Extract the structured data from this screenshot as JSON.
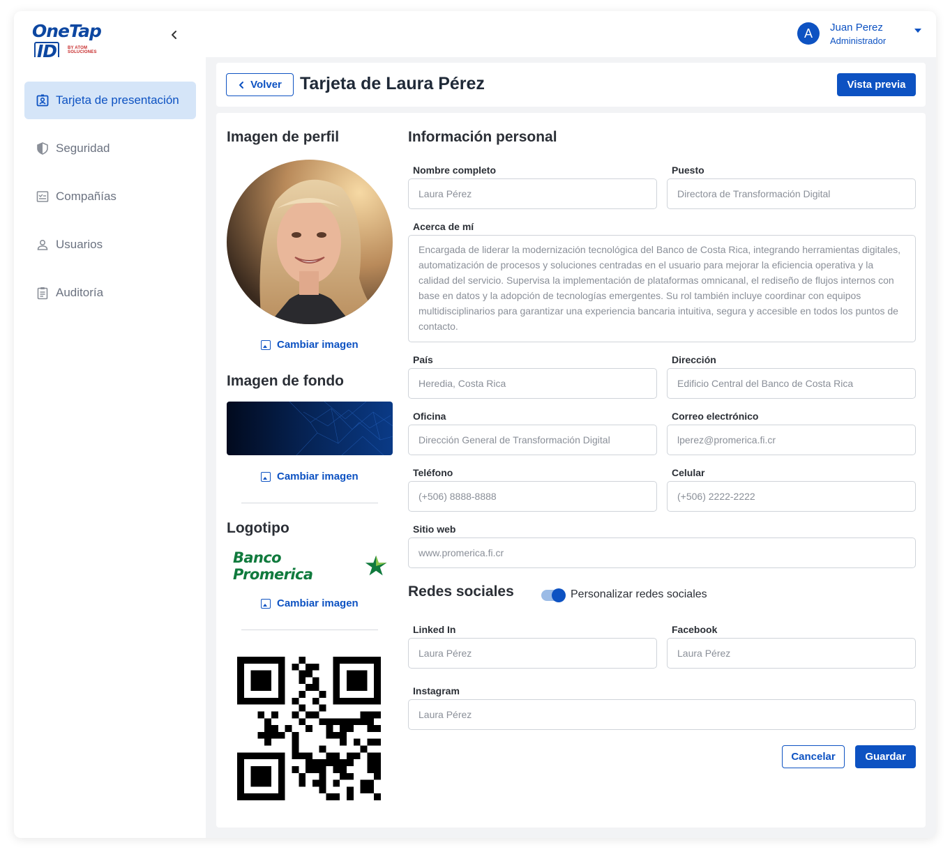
{
  "brand": {
    "logo_text": "OneTap",
    "logo_id": "ID",
    "logo_sub": "BY ATOM SOLUCIONES"
  },
  "user": {
    "initial": "A",
    "name": "Juan Perez",
    "role": "Administrador"
  },
  "sidebar": {
    "items": [
      {
        "label": "Tarjeta de presentación",
        "icon": "id-card-icon",
        "active": true
      },
      {
        "label": "Seguridad",
        "icon": "shield-icon",
        "active": false
      },
      {
        "label": "Compañías",
        "icon": "checklist-icon",
        "active": false
      },
      {
        "label": "Usuarios",
        "icon": "user-icon",
        "active": false
      },
      {
        "label": "Auditoría",
        "icon": "clipboard-icon",
        "active": false
      }
    ]
  },
  "header": {
    "back_label": "Volver",
    "title": "Tarjeta de Laura Pérez",
    "preview_label": "Vista previa"
  },
  "left_panel": {
    "profile_title": "Imagen de perfil",
    "change_image_label": "Cambiar imagen",
    "background_title": "Imagen de fondo",
    "logo_title": "Logotipo",
    "logo_brand_text": "Banco Promerica"
  },
  "personal": {
    "title": "Información personal",
    "fields": {
      "full_name": {
        "label": "Nombre completo",
        "value": "Laura Pérez"
      },
      "position": {
        "label": "Puesto",
        "value": "Directora de Transformación Digital"
      },
      "about": {
        "label": "Acerca de mí",
        "value": "Encargada de liderar la modernización tecnológica del Banco de Costa Rica, integrando herramientas digitales, automatización de procesos y soluciones centradas en el usuario para mejorar la eficiencia operativa y la calidad del servicio. Supervisa la implementación de plataformas omnicanal, el rediseño de flujos internos con base en datos y la adopción de tecnologías emergentes. Su rol también incluye coordinar con equipos multidisciplinarios para garantizar una experiencia bancaria intuitiva, segura y accesible en todos los puntos de contacto."
      },
      "country": {
        "label": "País",
        "value": "Heredia, Costa Rica"
      },
      "address": {
        "label": "Dirección",
        "value": "Edificio Central del Banco de Costa Rica"
      },
      "office": {
        "label": "Oficina",
        "value": "Dirección General de Transformación Digital"
      },
      "email": {
        "label": "Correo electrónico",
        "value": "lperez@promerica.fi.cr"
      },
      "phone": {
        "label": "Teléfono",
        "value": "(+506) 8888-8888"
      },
      "mobile": {
        "label": "Celular",
        "value": "(+506) 2222-2222"
      },
      "website": {
        "label": "Sitio web",
        "value": "www.promerica.fi.cr"
      }
    }
  },
  "social": {
    "title": "Redes sociales",
    "toggle_label": "Personalizar redes sociales",
    "toggle_on": true,
    "linkedin": {
      "label": "Linked In",
      "value": "Laura Pérez"
    },
    "facebook": {
      "label": "Facebook",
      "value": "Laura Pérez"
    },
    "instagram": {
      "label": "Instagram",
      "value": "Laura Pérez"
    }
  },
  "actions": {
    "cancel_label": "Cancelar",
    "save_label": "Guardar"
  },
  "colors": {
    "primary": "#0d52c2",
    "active_nav_bg": "#d5e5f8",
    "promerica_green": "#107a3d"
  }
}
